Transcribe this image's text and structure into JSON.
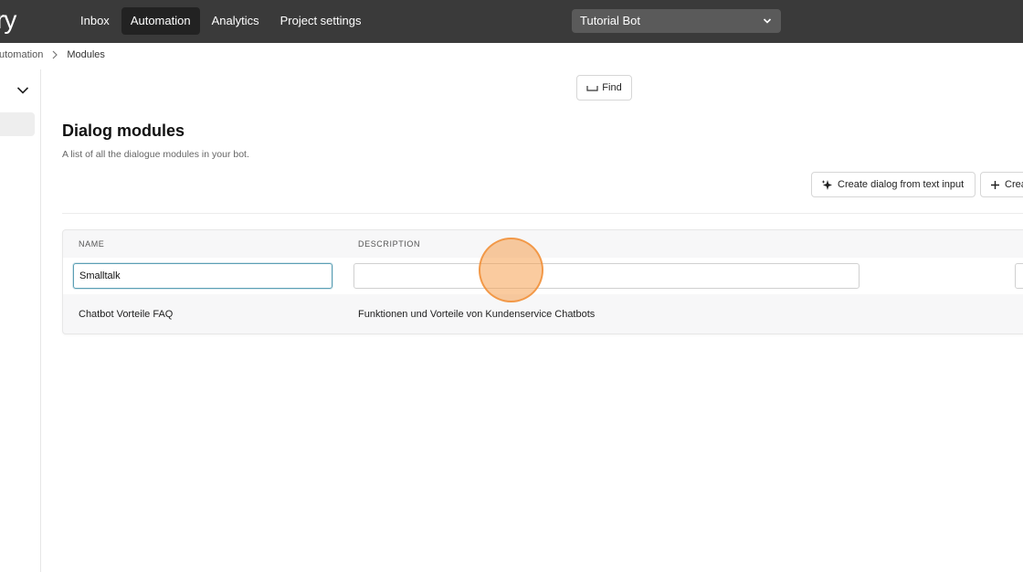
{
  "app": {
    "logo_text": "ry"
  },
  "nav": {
    "items": [
      {
        "label": "Inbox",
        "active": false
      },
      {
        "label": "Automation",
        "active": true
      },
      {
        "label": "Analytics",
        "active": false
      },
      {
        "label": "Project settings",
        "active": false
      }
    ]
  },
  "bot_selector": {
    "value": "Tutorial Bot",
    "icon": "chevron-down-icon"
  },
  "breadcrumb": {
    "parent": "utomation",
    "current": "Modules"
  },
  "find": {
    "label": "Find",
    "icon": "space-key-icon"
  },
  "page": {
    "title": "Dialog modules",
    "subtitle": "A list of all the dialogue modules in your bot."
  },
  "actions": {
    "ai_create_label": "Create dialog from text input",
    "ai_create_icon": "sparkle-icon",
    "create_label": "Crea",
    "create_icon": "plus-icon"
  },
  "table": {
    "columns": [
      "NAME",
      "DESCRIPTION"
    ],
    "new_row": {
      "name_value": "Smalltalk",
      "description_value": ""
    },
    "rows": [
      {
        "name": "Chatbot Vorteile FAQ",
        "description": "Funktionen und Vorteile von Kundenservice Chatbots"
      }
    ]
  },
  "colors": {
    "topbar": "#3a3a3a",
    "focus_border": "#5b9fb5",
    "cursor_highlight": "#f5a050"
  }
}
